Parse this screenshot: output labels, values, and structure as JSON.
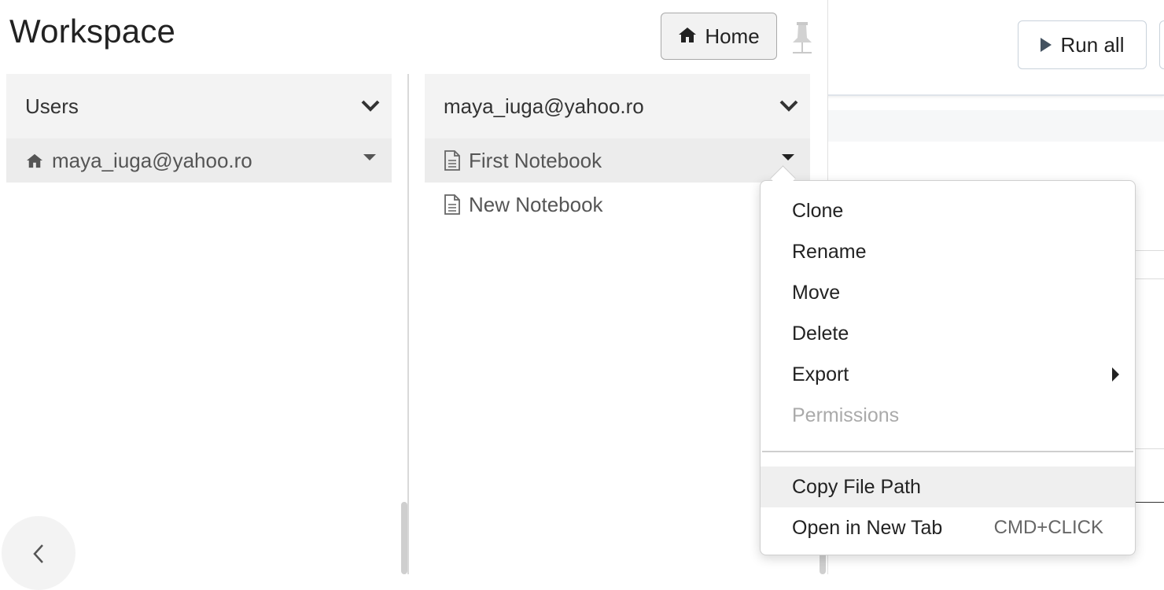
{
  "workspace": {
    "title": "Workspace",
    "home_label": "Home"
  },
  "columns": {
    "left": {
      "header": "Users",
      "items": [
        {
          "label": "maya_iuga@yahoo.ro",
          "icon": "home-icon"
        }
      ]
    },
    "middle": {
      "header": "maya_iuga@yahoo.ro",
      "items": [
        {
          "label": "First Notebook",
          "icon": "notebook-file-icon"
        },
        {
          "label": "New Notebook",
          "icon": "notebook-file-icon"
        }
      ]
    }
  },
  "context_menu": {
    "items": [
      {
        "label": "Clone"
      },
      {
        "label": "Rename"
      },
      {
        "label": "Move"
      },
      {
        "label": "Delete"
      },
      {
        "label": "Export"
      },
      {
        "label": "Permissions"
      },
      {
        "label": "Copy File Path"
      },
      {
        "label": "Open in New Tab",
        "shortcut": "CMD+CLICK"
      }
    ]
  },
  "notebook_toolbar": {
    "run_all_label": "Run all"
  }
}
